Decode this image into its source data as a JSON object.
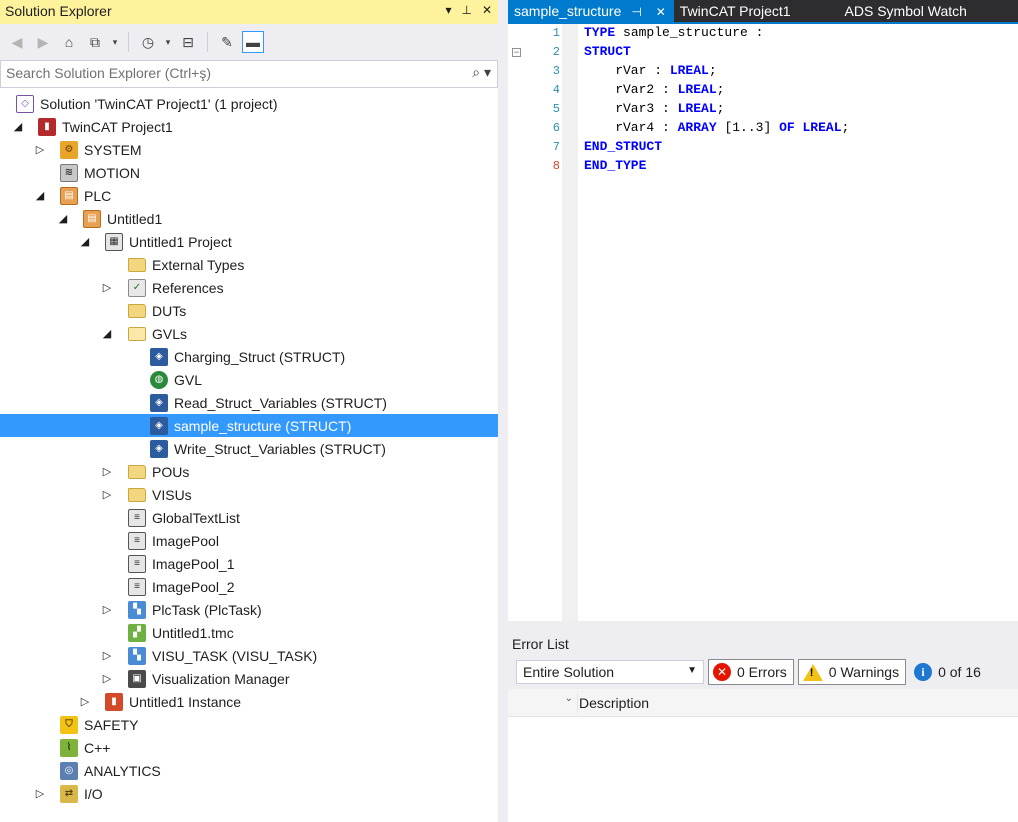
{
  "solution_explorer": {
    "title": "Solution Explorer",
    "search_placeholder": "Search Solution Explorer (Ctrl+ş)",
    "tree": [
      {
        "label": "Solution 'TwinCAT Project1' (1 project)",
        "icon": "solution-icon",
        "expander": "none"
      },
      {
        "label": "TwinCAT Project1",
        "icon": "twincat-project-icon",
        "expander": "expanded"
      },
      {
        "label": "SYSTEM",
        "icon": "system-icon",
        "expander": "collapsed"
      },
      {
        "label": "MOTION",
        "icon": "motion-icon",
        "expander": "none"
      },
      {
        "label": "PLC",
        "icon": "plc-icon",
        "expander": "expanded"
      },
      {
        "label": "Untitled1",
        "icon": "plc-project-icon",
        "expander": "expanded"
      },
      {
        "label": "Untitled1 Project",
        "icon": "plc-subproject-icon",
        "expander": "expanded"
      },
      {
        "label": "External Types",
        "icon": "folder-icon",
        "expander": "none"
      },
      {
        "label": "References",
        "icon": "references-icon",
        "expander": "collapsed"
      },
      {
        "label": "DUTs",
        "icon": "folder-icon",
        "expander": "none"
      },
      {
        "label": "GVLs",
        "icon": "folder-open-icon",
        "expander": "expanded"
      },
      {
        "label": "Charging_Struct (STRUCT)",
        "icon": "struct-icon",
        "expander": "none"
      },
      {
        "label": "GVL",
        "icon": "gvl-icon",
        "expander": "none"
      },
      {
        "label": "Read_Struct_Variables (STRUCT)",
        "icon": "struct-icon",
        "expander": "none"
      },
      {
        "label": "sample_structure (STRUCT)",
        "icon": "struct-icon",
        "expander": "none",
        "selected": true
      },
      {
        "label": "Write_Struct_Variables (STRUCT)",
        "icon": "struct-icon",
        "expander": "none"
      },
      {
        "label": "POUs",
        "icon": "folder-icon",
        "expander": "collapsed"
      },
      {
        "label": "VISUs",
        "icon": "folder-icon",
        "expander": "collapsed"
      },
      {
        "label": "GlobalTextList",
        "icon": "document-icon",
        "expander": "none"
      },
      {
        "label": "ImagePool",
        "icon": "document-icon",
        "expander": "none"
      },
      {
        "label": "ImagePool_1",
        "icon": "document-icon",
        "expander": "none"
      },
      {
        "label": "ImagePool_2",
        "icon": "document-icon",
        "expander": "none"
      },
      {
        "label": "PlcTask (PlcTask)",
        "icon": "task-icon",
        "expander": "collapsed"
      },
      {
        "label": "Untitled1.tmc",
        "icon": "tmc-icon",
        "expander": "none"
      },
      {
        "label": "VISU_TASK (VISU_TASK)",
        "icon": "task-icon",
        "expander": "collapsed"
      },
      {
        "label": "Visualization Manager",
        "icon": "visualization-manager-icon",
        "expander": "collapsed"
      },
      {
        "label": "Untitled1 Instance",
        "icon": "instance-icon",
        "expander": "collapsed"
      },
      {
        "label": "SAFETY",
        "icon": "safety-icon",
        "expander": "none"
      },
      {
        "label": "C++",
        "icon": "cpp-icon",
        "expander": "none"
      },
      {
        "label": "ANALYTICS",
        "icon": "analytics-icon",
        "expander": "none"
      },
      {
        "label": "I/O",
        "icon": "io-icon",
        "expander": "collapsed"
      }
    ]
  },
  "editor": {
    "tabs": [
      {
        "label": "sample_structure",
        "active": true
      },
      {
        "label": "TwinCAT Project1",
        "active": false
      },
      {
        "label": "ADS Symbol Watch",
        "active": false
      }
    ],
    "line_numbers": [
      "1",
      "2",
      "3",
      "4",
      "5",
      "6",
      "7",
      "8"
    ],
    "code": {
      "l1_kw": "TYPE",
      "l1_rest": " sample_structure :",
      "l2_kw": "STRUCT",
      "l3_name": "    rVar",
      "l3_sep": " : ",
      "l3_type": "LREAL",
      "l3_end": ";",
      "l4_name": "    rVar2",
      "l4_sep": " : ",
      "l4_type": "LREAL",
      "l4_end": ";",
      "l5_name": "    rVar3",
      "l5_sep": " : ",
      "l5_type": "LREAL",
      "l5_end": ";",
      "l6_name": "    rVar4",
      "l6_sep": " : ",
      "l6_kw1": "ARRAY",
      "l6_range": " [1..3] ",
      "l6_kw2": "OF",
      "l6_sp": " ",
      "l6_type": "LREAL",
      "l6_end": ";",
      "l7_kw": "END_STRUCT",
      "l8_kw": "END_TYPE"
    }
  },
  "error_list": {
    "title": "Error List",
    "scope": "Entire Solution",
    "errors": "0 Errors",
    "warnings": "0 Warnings",
    "messages": "0 of 16",
    "column_description": "Description"
  }
}
